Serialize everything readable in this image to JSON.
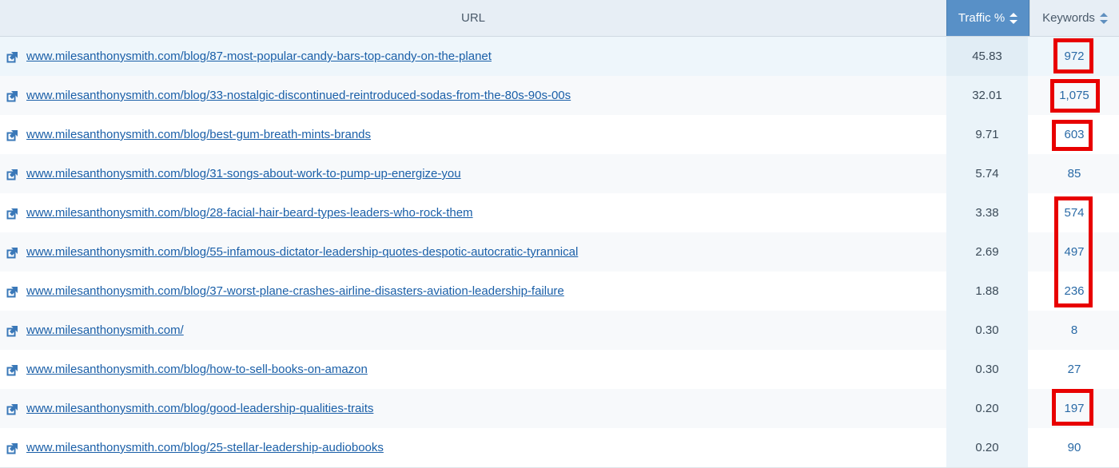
{
  "header": {
    "url_label": "URL",
    "traffic_label": "Traffic %",
    "keywords_label": "Keywords"
  },
  "rows": [
    {
      "url": "www.milesanthonysmith.com/blog/87-most-popular-candy-bars-top-candy-on-the-planet",
      "traffic": "45.83",
      "keywords": "972"
    },
    {
      "url": "www.milesanthonysmith.com/blog/33-nostalgic-discontinued-reintroduced-sodas-from-the-80s-90s-00s",
      "traffic": "32.01",
      "keywords": "1,075"
    },
    {
      "url": "www.milesanthonysmith.com/blog/best-gum-breath-mints-brands",
      "traffic": "9.71",
      "keywords": "603"
    },
    {
      "url": "www.milesanthonysmith.com/blog/31-songs-about-work-to-pump-up-energize-you",
      "traffic": "5.74",
      "keywords": "85"
    },
    {
      "url": "www.milesanthonysmith.com/blog/28-facial-hair-beard-types-leaders-who-rock-them",
      "traffic": "3.38",
      "keywords": "574"
    },
    {
      "url": "www.milesanthonysmith.com/blog/55-infamous-dictator-leadership-quotes-despotic-autocratic-tyrannical",
      "traffic": "2.69",
      "keywords": "497"
    },
    {
      "url": "www.milesanthonysmith.com/blog/37-worst-plane-crashes-airline-disasters-aviation-leadership-failure",
      "traffic": "1.88",
      "keywords": "236"
    },
    {
      "url": "www.milesanthonysmith.com/",
      "traffic": "0.30",
      "keywords": "8"
    },
    {
      "url": "www.milesanthonysmith.com/blog/how-to-sell-books-on-amazon",
      "traffic": "0.30",
      "keywords": "27"
    },
    {
      "url": "www.milesanthonysmith.com/blog/good-leadership-qualities-traits",
      "traffic": "0.20",
      "keywords": "197"
    },
    {
      "url": "www.milesanthonysmith.com/blog/25-stellar-leadership-audiobooks",
      "traffic": "0.20",
      "keywords": "90"
    }
  ],
  "icons": {
    "external_link": "external-link-icon",
    "sort": "sort-arrows-icon"
  },
  "colors": {
    "link": "#1a5fa8",
    "header_active": "#5890c7",
    "highlight_box": "#e80000"
  }
}
